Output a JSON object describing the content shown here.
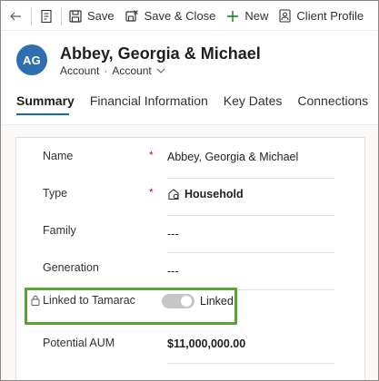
{
  "toolbar": {
    "save_label": "Save",
    "save_close_label": "Save & Close",
    "new_label": "New",
    "client_profile_label": "Client Profile"
  },
  "header": {
    "avatar_initials": "AG",
    "title": "Abbey, Georgia & Michael",
    "entity": "Account",
    "form_selector": "Account"
  },
  "tabs": [
    {
      "label": "Summary",
      "active": true
    },
    {
      "label": "Financial Information",
      "active": false
    },
    {
      "label": "Key Dates",
      "active": false
    },
    {
      "label": "Connections",
      "active": false
    }
  ],
  "fields": {
    "name": {
      "label": "Name",
      "required": "*",
      "value": "Abbey, Georgia & Michael"
    },
    "type": {
      "label": "Type",
      "required": "*",
      "value": "Household"
    },
    "family": {
      "label": "Family",
      "value": "---"
    },
    "generation": {
      "label": "Generation",
      "value": "---"
    },
    "linked": {
      "label": "Linked to Tamarac",
      "value": "Linked",
      "toggle_on": true
    },
    "potential_aum": {
      "label": "Potential AUM",
      "value": "$11,000,000.00"
    }
  },
  "colors": {
    "accent": "#0f6cbd",
    "avatar": "#2f6fb1",
    "highlight": "#5aa532",
    "required": "#a4262c"
  }
}
